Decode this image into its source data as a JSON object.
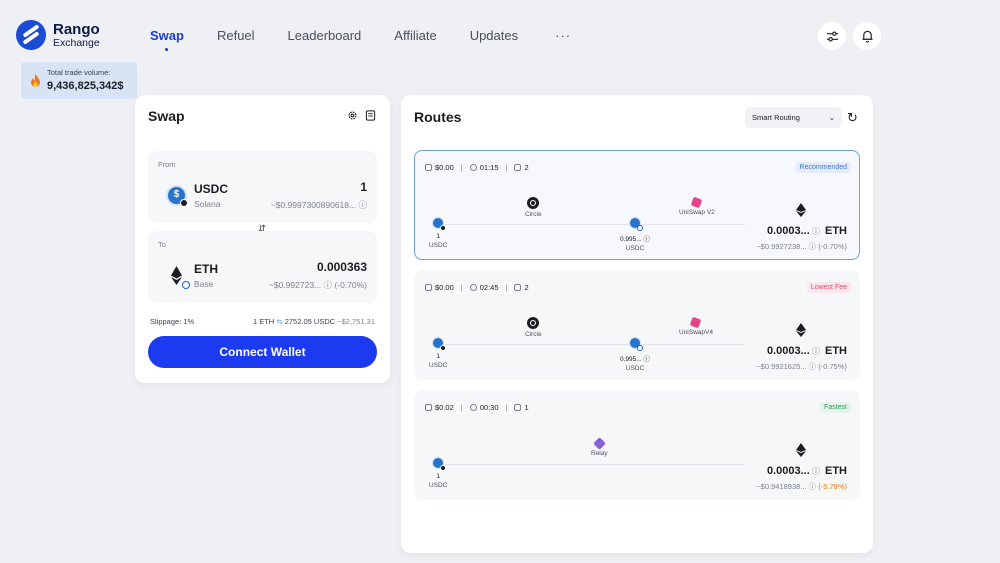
{
  "app": {
    "logo_title": "Rango",
    "logo_subtitle": "Exchange"
  },
  "nav": {
    "items": [
      {
        "label": "Swap",
        "active": true
      },
      {
        "label": "Refuel",
        "active": false
      },
      {
        "label": "Leaderboard",
        "active": false
      },
      {
        "label": "Affiliate",
        "active": false
      },
      {
        "label": "Updates",
        "active": false
      }
    ],
    "more": "···",
    "icons": [
      "settings-sliders-icon",
      "bell-icon"
    ]
  },
  "volume": {
    "label": "Total trade volume:",
    "value": "9,436,825,342$",
    "icon": "fire-icon"
  },
  "swap": {
    "title": "Swap",
    "icons": [
      "gear-icon",
      "history-icon"
    ],
    "from": {
      "label": "From",
      "symbol": "USDC",
      "chain": "Solana",
      "amount": "1",
      "usd": "~$0.9997300890618..."
    },
    "to": {
      "label": "To",
      "symbol": "ETH",
      "chain": "Base",
      "amount": "0.000363",
      "usd": "~$0.992723...",
      "pct": "(-0.70%)"
    },
    "slippage": "Slippage: 1%",
    "rate_left": "1 ETH",
    "rate_right": "2752.05 USDC",
    "rate_usd": "~$2,751.31",
    "connect_label": "Connect Wallet"
  },
  "routes": {
    "title": "Routes",
    "routing_select": "Smart Routing",
    "items": [
      {
        "fee": "$0.00",
        "time": "01:15",
        "steps": "2",
        "tag": "Recommended",
        "tag_color": "#3f76cf",
        "src_amount": "1",
        "src_symbol": "USDC",
        "bridge": "Circle",
        "mid_amount": "0.995...",
        "mid_symbol": "USDC",
        "dex": "UniSwap V2",
        "dest_amount": "0.0003...",
        "dest_symbol": "ETH",
        "dest_usd": "~$0.9927238...",
        "dest_pct": "(-0.70%)"
      },
      {
        "fee": "$0.00",
        "time": "02:45",
        "steps": "2",
        "tag": "Lowest Fee",
        "tag_color": "#d7497a",
        "src_amount": "1",
        "src_symbol": "USDC",
        "bridge": "Circle",
        "mid_amount": "0.995...",
        "mid_symbol": "USDC",
        "dex": "UniSwapV4",
        "dest_amount": "0.0003...",
        "dest_symbol": "ETH",
        "dest_usd": "~$0.9921625...",
        "dest_pct": "(-0.75%)"
      },
      {
        "fee": "$0.02",
        "time": "00:30",
        "steps": "1",
        "tag": "Fastest",
        "tag_color": "#2f9b58",
        "src_amount": "1",
        "src_symbol": "USDC",
        "bridge": "Relay",
        "dest_amount": "0.0003...",
        "dest_symbol": "ETH",
        "dest_usd": "~$0.9418938...",
        "dest_pct": "(-5.78%)"
      }
    ]
  }
}
